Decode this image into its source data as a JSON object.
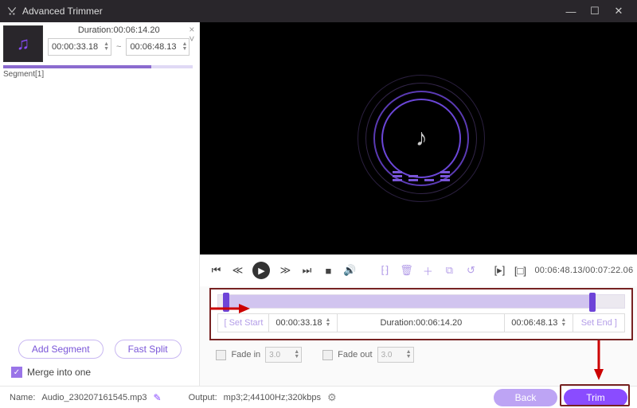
{
  "window": {
    "title": "Advanced Trimmer",
    "min": "—",
    "max": "☐",
    "close": "✕"
  },
  "segment": {
    "label": "Segment[1]",
    "duration_prefix": "Duration:",
    "duration": "00:06:14.20",
    "start": "00:00:33.18",
    "end": "00:06:48.13",
    "tilde": "~"
  },
  "buttons": {
    "add_segment": "Add Segment",
    "fast_split": "Fast Split",
    "back": "Back",
    "trim": "Trim"
  },
  "merge": {
    "label": "Merge into one",
    "checked": true
  },
  "toolbar": {
    "time": "00:06:48.13/00:07:22.06"
  },
  "trim": {
    "set_start_label": "[  Set Start",
    "set_end_label": "Set End  ]",
    "start": "00:00:33.18",
    "end": "00:06:48.13",
    "duration_label": "Duration:00:06:14.20"
  },
  "fade": {
    "in_label": "Fade in",
    "in_value": "3.0",
    "out_label": "Fade out",
    "out_value": "3.0"
  },
  "footer": {
    "name_label": "Name:",
    "name_value": "Audio_230207161545.mp3",
    "output_label": "Output:",
    "output_value": "mp3;2;44100Hz;320kbps"
  }
}
